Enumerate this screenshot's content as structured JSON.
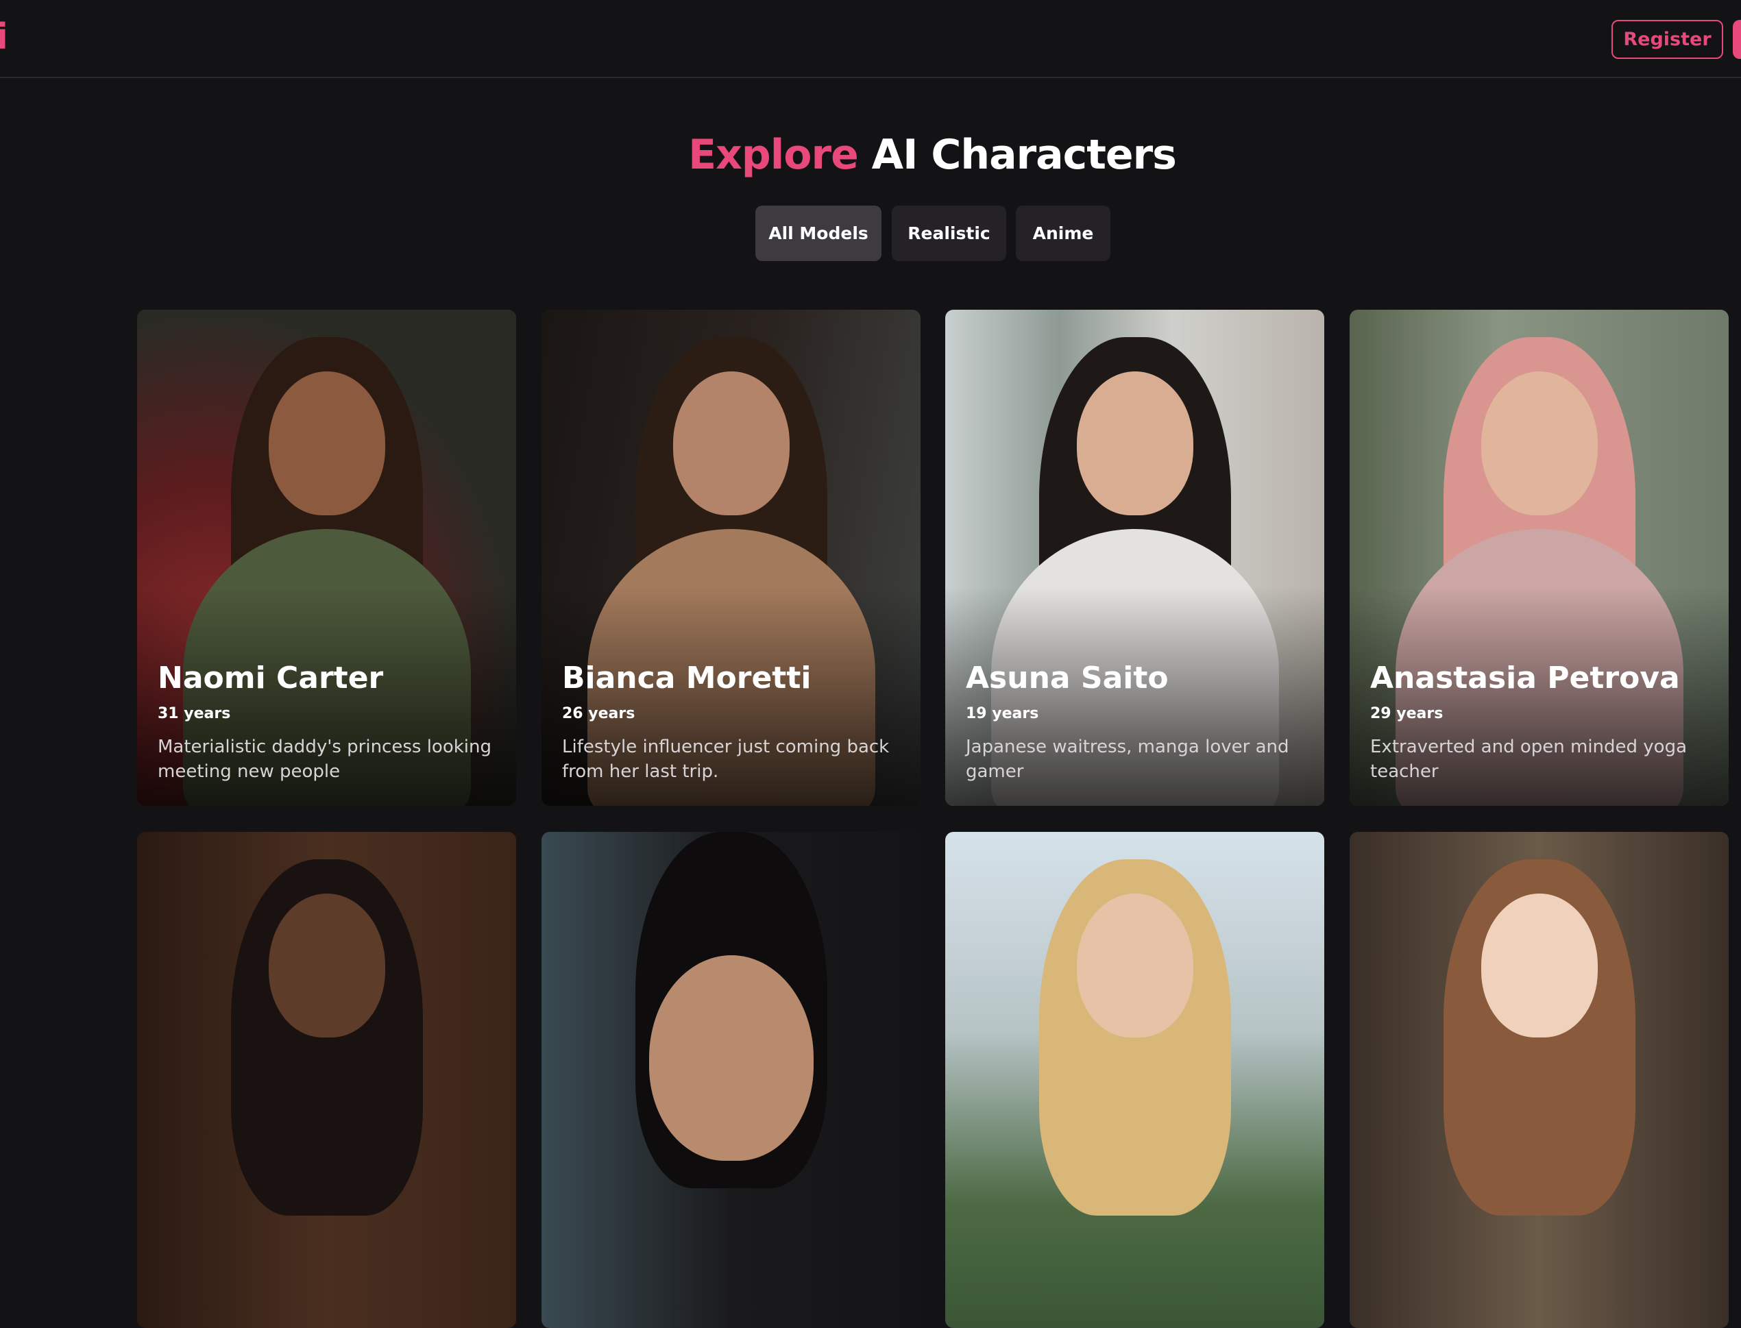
{
  "header": {
    "logo_text": "i",
    "register_label": "Register"
  },
  "main": {
    "title_accent": "Explore",
    "title_rest": " AI Characters",
    "filters": [
      {
        "label": "All Models",
        "active": true
      },
      {
        "label": "Realistic",
        "active": false
      },
      {
        "label": "Anime",
        "active": false
      }
    ]
  },
  "characters": [
    {
      "name": "Naomi Carter",
      "age": "31 years",
      "description": "Materialistic daddy's princess looking meeting new people"
    },
    {
      "name": "Bianca Moretti",
      "age": "26 years",
      "description": "Lifestyle influencer just coming back from her last trip."
    },
    {
      "name": "Asuna Saito",
      "age": "19 years",
      "description": "Japanese waitress, manga lover and gamer"
    },
    {
      "name": "Anastasia Petrova",
      "age": "29 years",
      "description": "Extraverted and open minded yoga teacher"
    }
  ],
  "colors": {
    "accent": "#e8497a",
    "background": "#131215",
    "filter_bg": "#242227",
    "filter_active_bg": "#3d3b40"
  }
}
